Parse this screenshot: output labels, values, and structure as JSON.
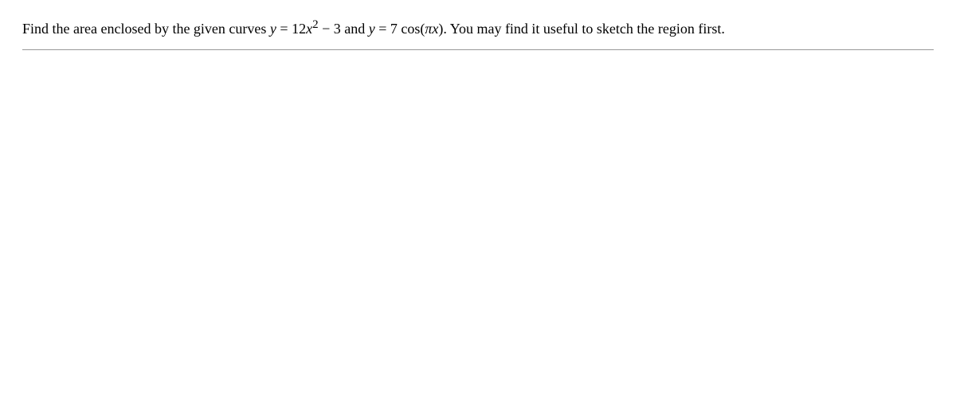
{
  "problem": {
    "part1": "Find the area enclosed by the given curves ",
    "eq1_lhs": "y",
    "eq1_eq": " = ",
    "eq1_rhs_coef": "12",
    "eq1_rhs_var": "x",
    "eq1_rhs_exp": "2",
    "eq1_rhs_tail": " − 3",
    "between": "   and   ",
    "eq2_lhs": "y",
    "eq2_eq": " = ",
    "eq2_rhs_coef": "7",
    "eq2_rhs_func": " cos(",
    "eq2_rhs_pi": "π",
    "eq2_rhs_var": "x",
    "eq2_rhs_close": ").",
    "part2": " You may find it useful to sketch the region first."
  }
}
